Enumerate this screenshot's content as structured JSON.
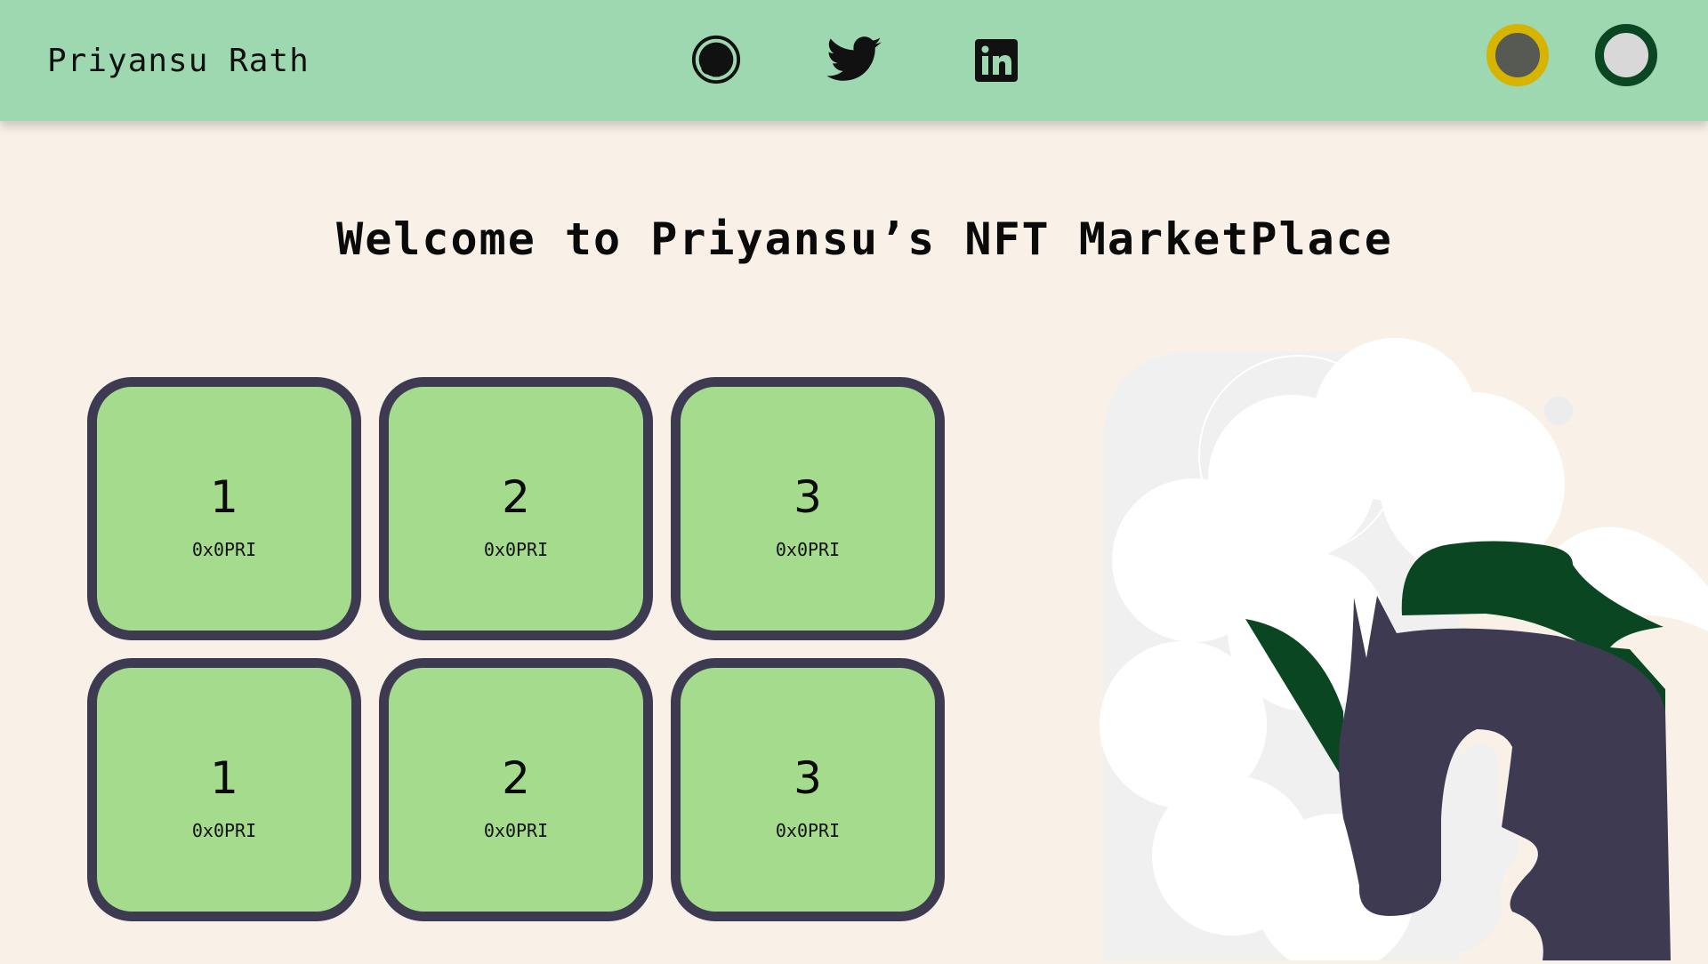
{
  "navbar": {
    "brand": "Priyansu Rath",
    "social_icons": [
      "github-icon",
      "twitter-icon",
      "linkedin-icon"
    ],
    "theme_toggles": [
      "dark-theme-toggle",
      "light-theme-toggle"
    ]
  },
  "main": {
    "heading": "Welcome to Priyansu’s NFT MarketPlace",
    "cards": [
      {
        "number": "1",
        "owner": "0x0PRI"
      },
      {
        "number": "2",
        "owner": "0x0PRI"
      },
      {
        "number": "3",
        "owner": "0x0PRI"
      },
      {
        "number": "1",
        "owner": "0x0PRI"
      },
      {
        "number": "2",
        "owner": "0x0PRI"
      },
      {
        "number": "3",
        "owner": "0x0PRI"
      }
    ]
  },
  "colors": {
    "navbar": "#9ed8b0",
    "background": "#f9f1e8",
    "card_fill": "#a5db8c",
    "card_border": "#3e3a52",
    "accent_dark_green": "#0b4623",
    "accent_gold": "#d6b400"
  },
  "illustration": "horse-illustration"
}
